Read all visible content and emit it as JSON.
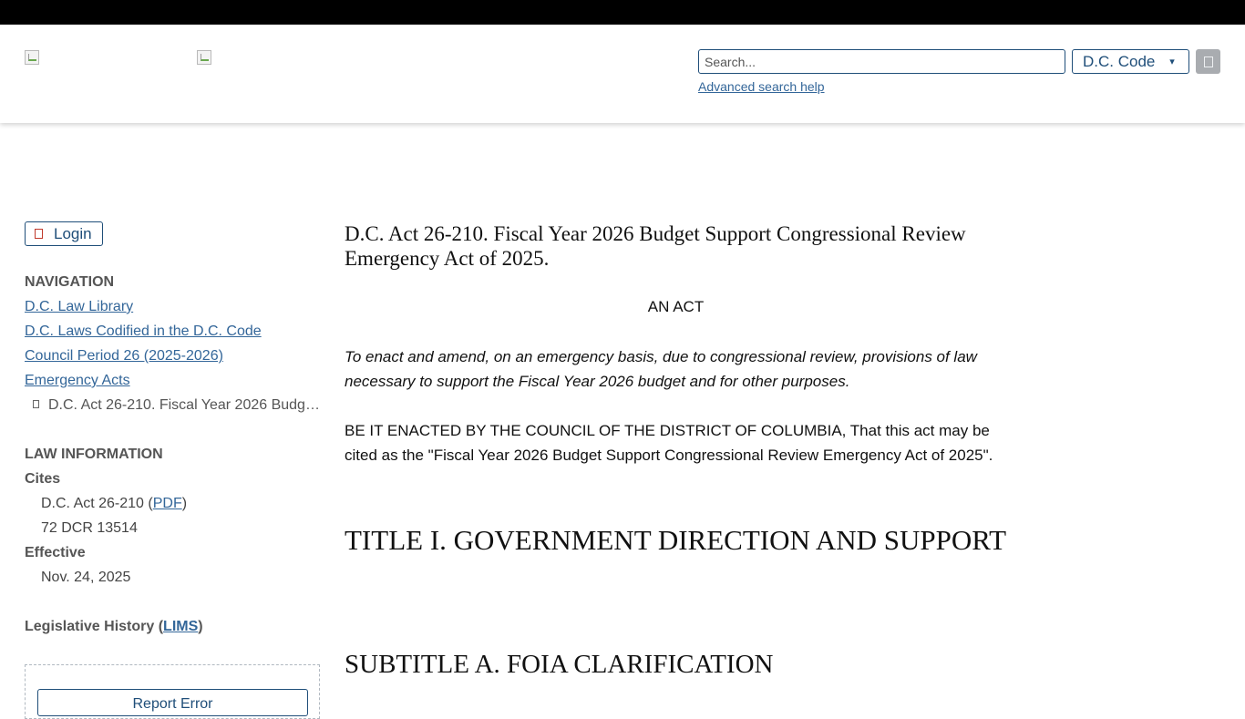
{
  "header": {
    "search_placeholder": "Search...",
    "scope_label": "D.C. Code",
    "advanced_search_label": "Advanced search help"
  },
  "sidebar": {
    "login_label": "Login",
    "navigation_heading": "NAVIGATION",
    "nav_items": [
      "D.C. Law Library",
      "D.C. Laws Codified in the D.C. Code",
      "Council Period 26 (2025-2026)",
      "Emergency Acts"
    ],
    "current_item": "D.C. Act 26-210. Fiscal Year 2026 Budget Support Congressional Review Emergency Act of 2025.",
    "law_info_heading": "LAW INFORMATION",
    "cites_label": "Cites",
    "cite_act_prefix": "D.C. Act 26-210 (",
    "cite_pdf_link": "PDF",
    "cite_act_suffix": ")",
    "cite_dcr": "72 DCR 13514",
    "effective_label": "Effective",
    "effective_date": "Nov. 24, 2025",
    "legislative_history_prefix": "Legislative History (",
    "legislative_history_link": "LIMS",
    "legislative_history_suffix": ")",
    "report_error_label": "Report Error"
  },
  "main": {
    "title": "D.C. Act 26-210. Fiscal Year 2026 Budget Support Congressional Review Emergency Act of 2025.",
    "an_act": "AN ACT",
    "purpose": "To enact and amend, on an emergency basis, due to congressional review, provisions of law necessary to support the Fiscal Year 2026 budget and for other purposes.",
    "enacting_clause": "BE IT ENACTED BY THE COUNCIL OF THE DISTRICT OF COLUMBIA, That this act may be cited as the \"Fiscal Year 2026 Budget Support Congressional Review Emergency Act of 2025\".",
    "title_heading": "TITLE I. GOVERNMENT DIRECTION AND SUPPORT",
    "subtitle_heading": "SUBTITLE A. FOIA CLARIFICATION"
  },
  "colors": {
    "accent": "#1f4e79",
    "link": "#336699",
    "topbar": "#000000",
    "go_button": "#a9acb0",
    "login_icon": "#c0392b"
  },
  "icons": {
    "login": "login-icon",
    "scope": "chevron-down-icon",
    "search": "search-icon",
    "current_item": "bullet-icon",
    "logos": [
      "broken-image-icon",
      "broken-image-icon"
    ]
  }
}
